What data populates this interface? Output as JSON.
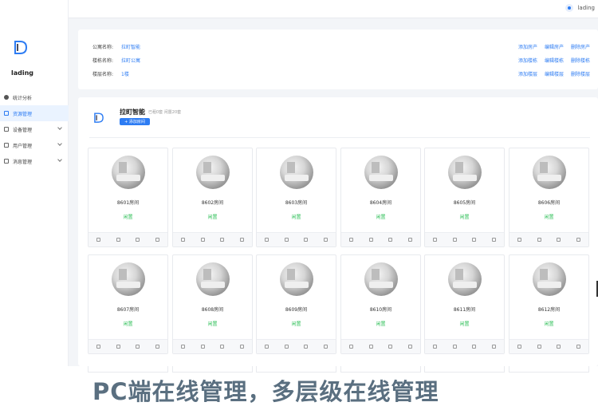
{
  "topbar": {
    "username": "lading"
  },
  "sidebar": {
    "brand": "lading",
    "items": [
      {
        "label": "统计分析",
        "icon": "chart-icon"
      },
      {
        "label": "资源管理",
        "icon": "resource-icon",
        "active": true
      },
      {
        "label": "设备管理",
        "icon": "device-icon"
      },
      {
        "label": "用户管理",
        "icon": "user-icon"
      },
      {
        "label": "消息管理",
        "icon": "message-icon"
      }
    ]
  },
  "info": {
    "rows": [
      {
        "key": "公寓名称:",
        "value": "拉町智能",
        "actions": [
          "添加房产",
          "编辑房产",
          "删除房产"
        ]
      },
      {
        "key": "楼栋名称:",
        "value": "拉町公寓",
        "actions": [
          "添加楼栋",
          "编辑楼栋",
          "删除楼栋"
        ]
      },
      {
        "key": "楼层名称:",
        "value": "1楼",
        "actions": [
          "添加楼层",
          "编辑楼层",
          "删除楼层"
        ]
      }
    ]
  },
  "project": {
    "name": "拉町智能",
    "stats": "已租0套  闲置20套",
    "add_label": "+ 添加房间"
  },
  "rooms": [
    {
      "name": "8601房间",
      "status": "闲置"
    },
    {
      "name": "8602房间",
      "status": "闲置"
    },
    {
      "name": "8603房间",
      "status": "闲置"
    },
    {
      "name": "8604房间",
      "status": "闲置"
    },
    {
      "name": "8605房间",
      "status": "闲置"
    },
    {
      "name": "8606房间",
      "status": "闲置"
    },
    {
      "name": "8607房间",
      "status": "闲置"
    },
    {
      "name": "8608房间",
      "status": "闲置"
    },
    {
      "name": "8609房间",
      "status": "闲置"
    },
    {
      "name": "8610房间",
      "status": "闲置"
    },
    {
      "name": "8611房间",
      "status": "闲置"
    },
    {
      "name": "8612房间",
      "status": "闲置"
    }
  ],
  "banner": "PC端在线管理，多层级在线管理",
  "colors": {
    "accent": "#2d7cf3",
    "status_idle": "#2cbf56",
    "banner": "#5a6f80"
  }
}
